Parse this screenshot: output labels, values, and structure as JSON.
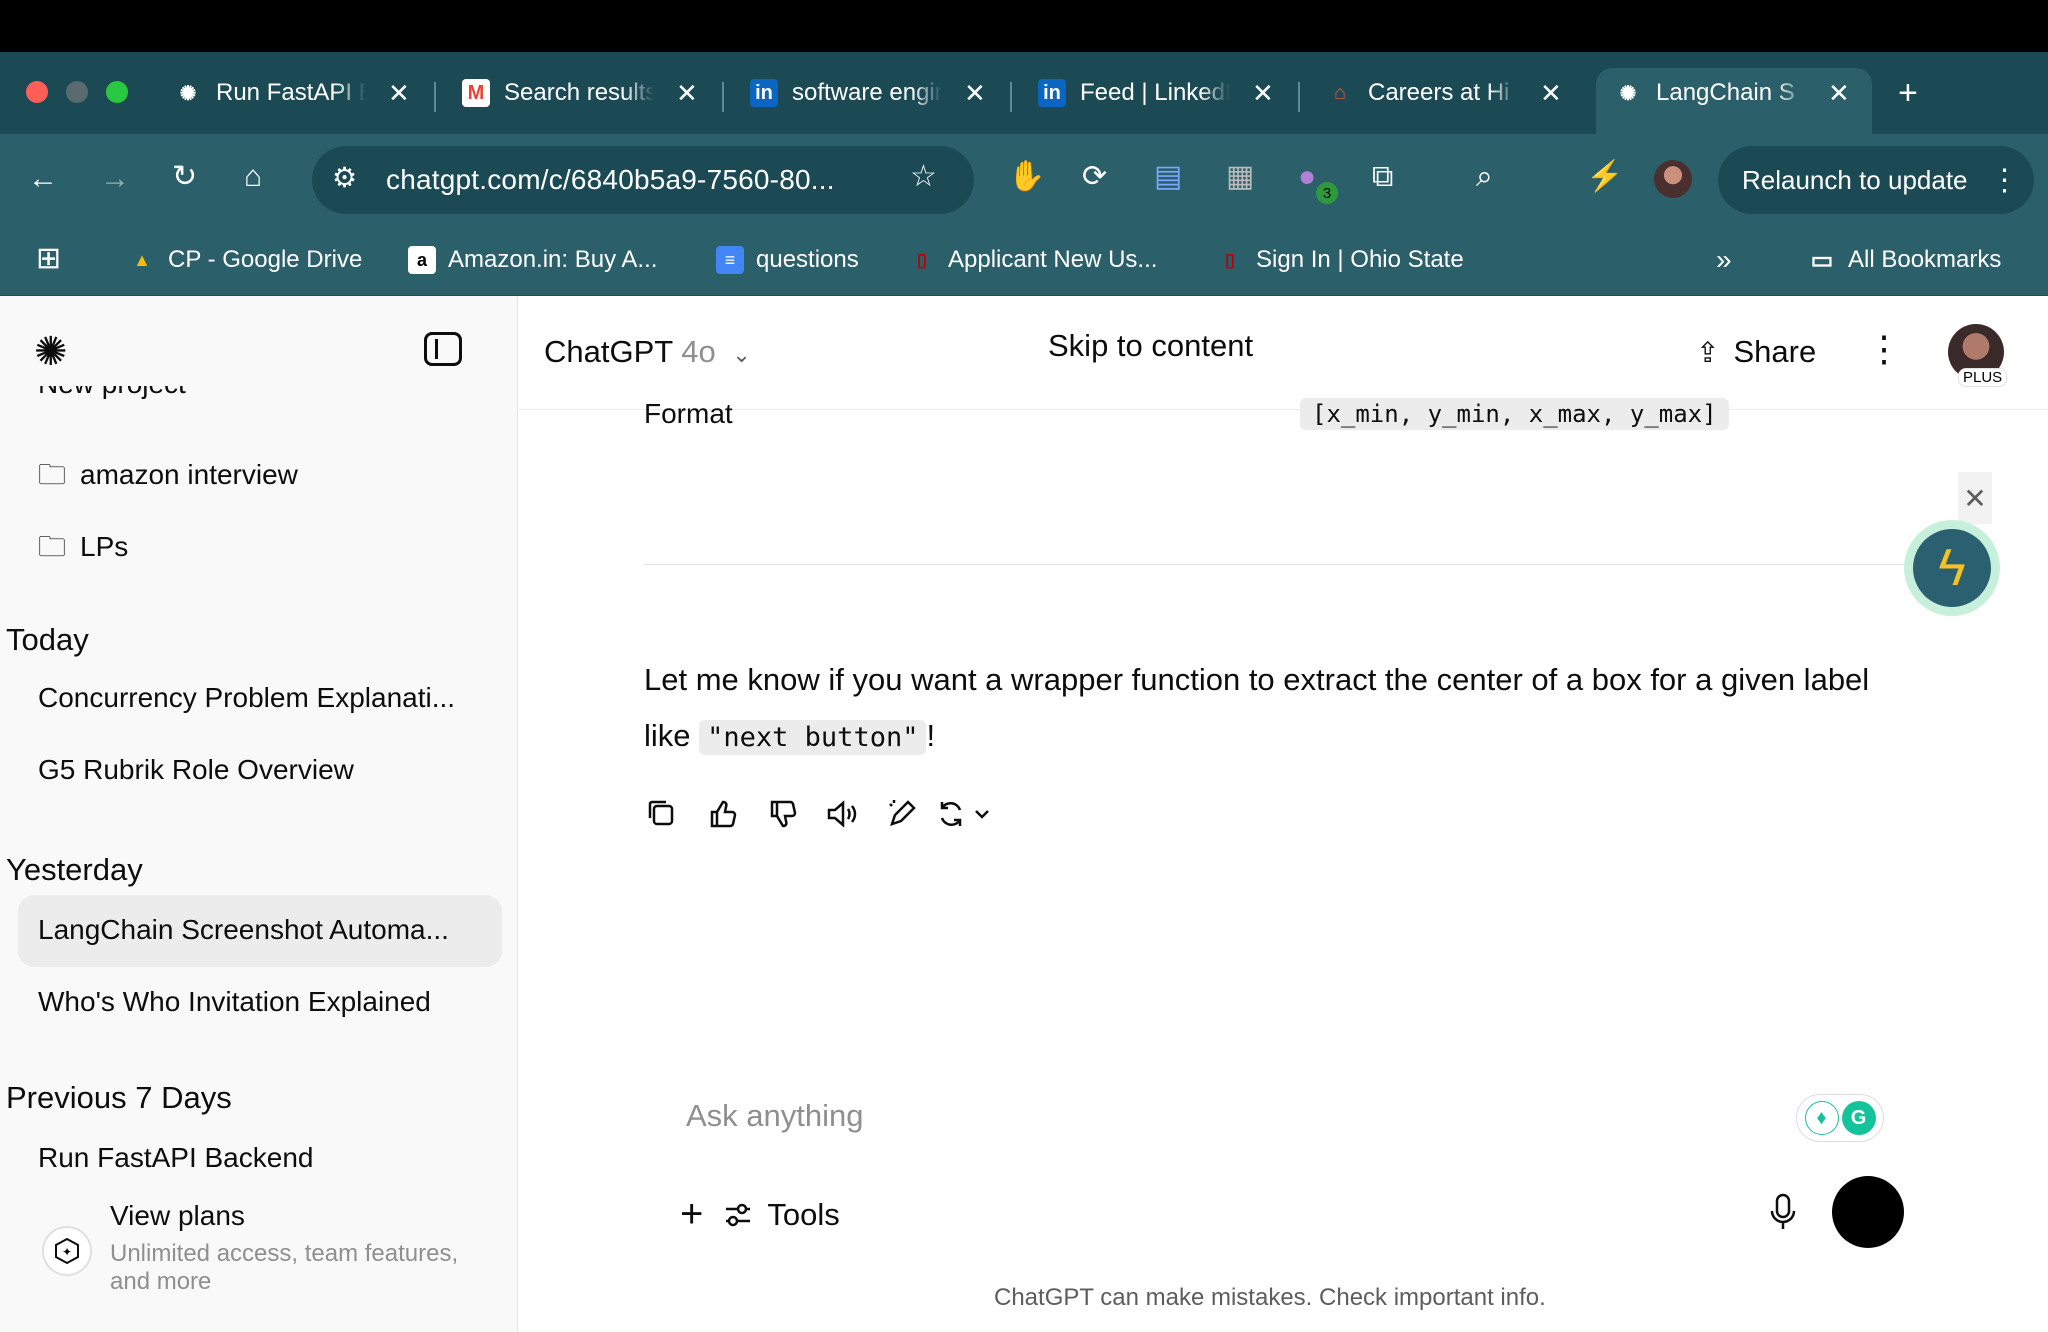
{
  "browser": {
    "tabs": [
      {
        "title": "Run FastAPI Backend",
        "favicon": "chatgpt-icon"
      },
      {
        "title": "Search results",
        "favicon": "gmail-icon"
      },
      {
        "title": "software engineer",
        "favicon": "linkedin-icon"
      },
      {
        "title": "Feed | LinkedIn",
        "favicon": "linkedin-icon"
      },
      {
        "title": "Careers at Hi",
        "favicon": "careers-icon"
      },
      {
        "title": "LangChain S",
        "favicon": "chatgpt-icon"
      }
    ],
    "new_tab": "+",
    "url": "chatgpt.com/c/6840b5a9-7560-80...",
    "relaunch": "Relaunch to update",
    "extension_badge": "3",
    "bookmarks": [
      {
        "label": "CP - Google Drive",
        "icon": "drive-icon"
      },
      {
        "label": "Amazon.in: Buy A...",
        "icon": "amazon-icon"
      },
      {
        "label": "questions",
        "icon": "docs-icon"
      },
      {
        "label": "Applicant New Us...",
        "icon": "osu-icon"
      },
      {
        "label": "Sign In | Ohio State",
        "icon": "osu-icon"
      }
    ],
    "all_bookmarks": "All Bookmarks"
  },
  "sidebar": {
    "partial_item": "New project",
    "projects": [
      "amazon interview",
      "LPs"
    ],
    "sections": [
      {
        "heading": "Today",
        "items": [
          "Concurrency Problem Explanati...",
          "G5 Rubrik Role Overview"
        ]
      },
      {
        "heading": "Yesterday",
        "items": [
          "LangChain Screenshot Automa...",
          "Who's Who Invitation Explained"
        ]
      },
      {
        "heading": "Previous 7 Days",
        "items": [
          "Run FastAPI Backend"
        ]
      }
    ],
    "view_plans": {
      "title": "View plans",
      "subtitle_line1": "Unlimited access, team features,",
      "subtitle_line2": "and more"
    }
  },
  "header": {
    "model_name": "ChatGPT",
    "model_version": "4o",
    "skip": "Skip to content",
    "share": "Share",
    "plan_badge": "PLUS"
  },
  "conversation": {
    "format_label": "Format",
    "format_value": "[x_min, y_min, x_max, y_max]",
    "message_part1": "Let me know if you want a wrapper function to extract the center of a box for a given label like ",
    "message_code": "\"next button\"",
    "message_part2": "!"
  },
  "composer": {
    "placeholder": "Ask anything",
    "tools": "Tools",
    "disclaimer": "ChatGPT can make mistakes. Check important info."
  },
  "colors": {
    "tabstrip": "#1b4a54",
    "toolbar": "#2b5f6a",
    "sidebar": "#f9f9f9"
  }
}
